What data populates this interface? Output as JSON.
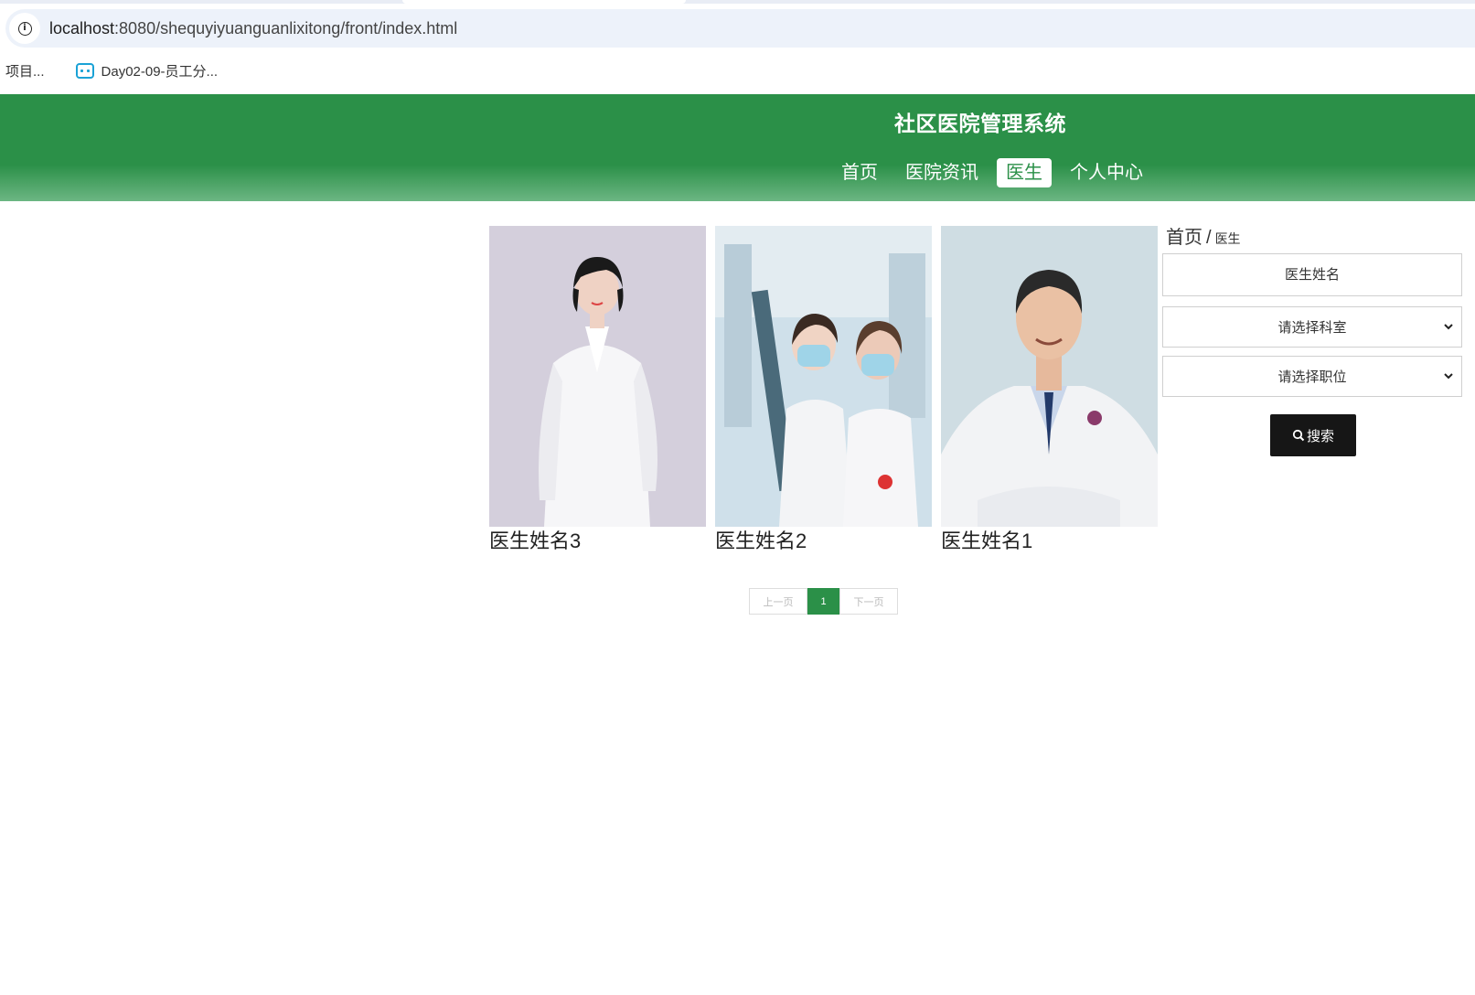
{
  "browser": {
    "url_host": "localhost",
    "url_path": ":8080/shequyiyuanguanlixitong/front/index.html",
    "bookmarks": [
      {
        "label": "项目..."
      },
      {
        "label": "Day02-09-员工分..."
      }
    ]
  },
  "header": {
    "title": "社区医院管理系统",
    "nav": [
      {
        "label": "首页"
      },
      {
        "label": "医院资讯"
      },
      {
        "label": "医生"
      },
      {
        "label": "个人中心"
      }
    ],
    "active_nav": "医生",
    "color": "#2b9048"
  },
  "doctors": [
    {
      "name": "医生姓名3"
    },
    {
      "name": "医生姓名2"
    },
    {
      "name": "医生姓名1"
    }
  ],
  "breadcrumb": {
    "home": "首页",
    "separator": "/",
    "current": "医生"
  },
  "search": {
    "name_placeholder": "医生姓名",
    "department_select": "请选择科室",
    "position_select": "请选择职位",
    "button_label": "搜索"
  },
  "pagination": {
    "prev": "上一页",
    "current_page": "1",
    "next": "下一页"
  }
}
